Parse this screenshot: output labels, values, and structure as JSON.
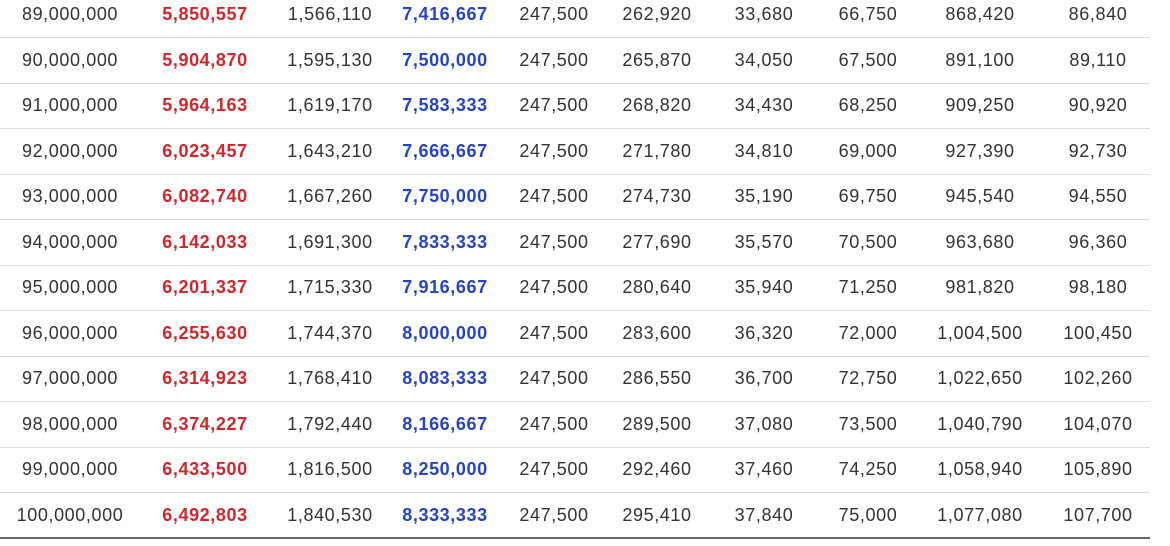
{
  "table": {
    "column_colors": [
      "#333333",
      "#d3252b",
      "#333333",
      "#2643c6",
      "#333333",
      "#333333",
      "#333333",
      "#333333",
      "#333333",
      "#333333"
    ],
    "column_bold": [
      false,
      true,
      false,
      true,
      false,
      false,
      false,
      false,
      false,
      false
    ],
    "rows": [
      [
        "89,000,000",
        "5,850,557",
        "1,566,110",
        "7,416,667",
        "247,500",
        "262,920",
        "33,680",
        "66,750",
        "868,420",
        "86,840"
      ],
      [
        "90,000,000",
        "5,904,870",
        "1,595,130",
        "7,500,000",
        "247,500",
        "265,870",
        "34,050",
        "67,500",
        "891,100",
        "89,110"
      ],
      [
        "91,000,000",
        "5,964,163",
        "1,619,170",
        "7,583,333",
        "247,500",
        "268,820",
        "34,430",
        "68,250",
        "909,250",
        "90,920"
      ],
      [
        "92,000,000",
        "6,023,457",
        "1,643,210",
        "7,666,667",
        "247,500",
        "271,780",
        "34,810",
        "69,000",
        "927,390",
        "92,730"
      ],
      [
        "93,000,000",
        "6,082,740",
        "1,667,260",
        "7,750,000",
        "247,500",
        "274,730",
        "35,190",
        "69,750",
        "945,540",
        "94,550"
      ],
      [
        "94,000,000",
        "6,142,033",
        "1,691,300",
        "7,833,333",
        "247,500",
        "277,690",
        "35,570",
        "70,500",
        "963,680",
        "96,360"
      ],
      [
        "95,000,000",
        "6,201,337",
        "1,715,330",
        "7,916,667",
        "247,500",
        "280,640",
        "35,940",
        "71,250",
        "981,820",
        "98,180"
      ],
      [
        "96,000,000",
        "6,255,630",
        "1,744,370",
        "8,000,000",
        "247,500",
        "283,600",
        "36,320",
        "72,000",
        "1,004,500",
        "100,450"
      ],
      [
        "97,000,000",
        "6,314,923",
        "1,768,410",
        "8,083,333",
        "247,500",
        "286,550",
        "36,700",
        "72,750",
        "1,022,650",
        "102,260"
      ],
      [
        "98,000,000",
        "6,374,227",
        "1,792,440",
        "8,166,667",
        "247,500",
        "289,500",
        "37,080",
        "73,500",
        "1,040,790",
        "104,070"
      ],
      [
        "99,000,000",
        "6,433,500",
        "1,816,500",
        "8,250,000",
        "247,500",
        "292,460",
        "37,460",
        "74,250",
        "1,058,940",
        "105,890"
      ],
      [
        "100,000,000",
        "6,492,803",
        "1,840,530",
        "8,333,333",
        "247,500",
        "295,410",
        "37,840",
        "75,000",
        "1,077,080",
        "107,700"
      ]
    ]
  }
}
